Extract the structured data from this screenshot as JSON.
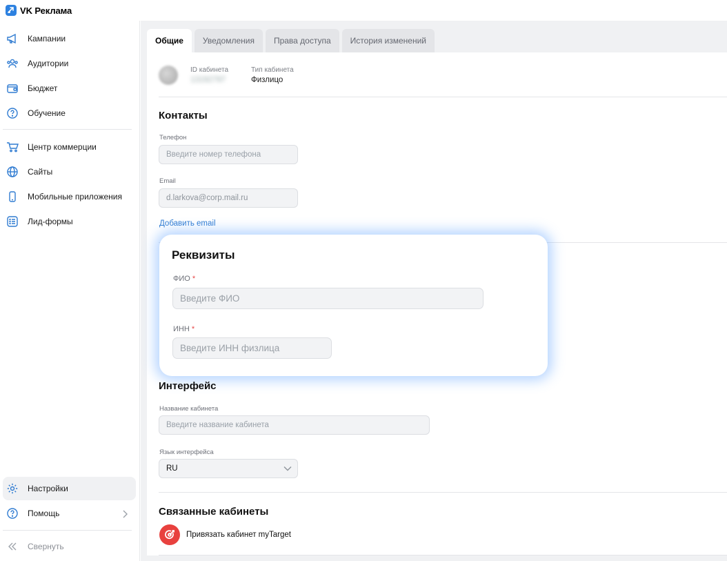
{
  "app": {
    "title": "VK Реклама"
  },
  "sidebar": {
    "items": [
      {
        "label": "Кампании",
        "icon": "megaphone-icon"
      },
      {
        "label": "Аудитории",
        "icon": "people-icon"
      },
      {
        "label": "Бюджет",
        "icon": "wallet-icon"
      },
      {
        "label": "Обучение",
        "icon": "question-circle-icon"
      },
      {
        "label": "Центр коммерции",
        "icon": "cart-icon"
      },
      {
        "label": "Сайты",
        "icon": "globe-icon"
      },
      {
        "label": "Мобильные приложения",
        "icon": "phone-icon"
      },
      {
        "label": "Лид-формы",
        "icon": "list-form-icon"
      }
    ],
    "settings": "Настройки",
    "help": "Помощь",
    "collapse": "Свернуть"
  },
  "tabs": [
    {
      "label": "Общие",
      "active": true
    },
    {
      "label": "Уведомления",
      "active": false
    },
    {
      "label": "Права доступа",
      "active": false
    },
    {
      "label": "История изменений",
      "active": false
    }
  ],
  "account": {
    "id_label": "ID кабинета",
    "id_value": "13192797",
    "type_label": "Тип кабинета",
    "type_value": "Физлицо"
  },
  "contacts": {
    "title": "Контакты",
    "phone_label": "Телефон",
    "phone_placeholder": "Введите номер телефона",
    "email_label": "Email",
    "email_value": "d.larkova@corp.mail.ru",
    "add_email": "Добавить email"
  },
  "requisites": {
    "title": "Реквизиты",
    "fio_label": "ФИО",
    "fio_placeholder": "Введите ФИО",
    "inn_label": "ИНН",
    "inn_placeholder": "Введите ИНН физлица",
    "required_mark": "*"
  },
  "interface": {
    "title": "Интерфейс",
    "name_label": "Название кабинета",
    "name_placeholder": "Введите название кабинета",
    "lang_label": "Язык интерфейса",
    "lang_value": "RU"
  },
  "linked": {
    "title": "Связанные кабинеты",
    "mytarget_label": "Привязать кабинет myTarget"
  },
  "colors": {
    "accent": "#2f7bd1",
    "logo": "#2d81e0",
    "required": "#e64646",
    "mytarget": "#e8413e",
    "highlight_glow": "#5aa0ff"
  }
}
